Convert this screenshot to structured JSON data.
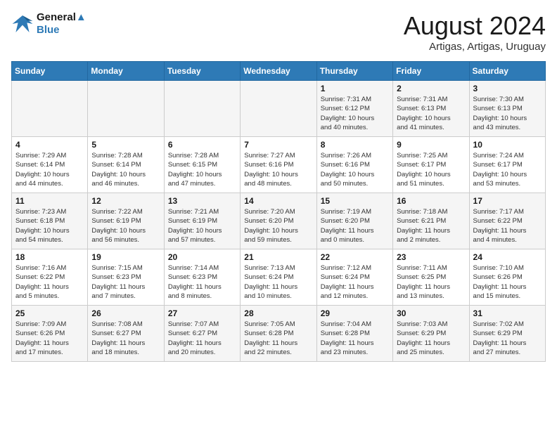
{
  "header": {
    "logo_line1": "General",
    "logo_line2": "Blue",
    "month_title": "August 2024",
    "location": "Artigas, Artigas, Uruguay"
  },
  "weekdays": [
    "Sunday",
    "Monday",
    "Tuesday",
    "Wednesday",
    "Thursday",
    "Friday",
    "Saturday"
  ],
  "weeks": [
    [
      {
        "day": "",
        "info": ""
      },
      {
        "day": "",
        "info": ""
      },
      {
        "day": "",
        "info": ""
      },
      {
        "day": "",
        "info": ""
      },
      {
        "day": "1",
        "info": "Sunrise: 7:31 AM\nSunset: 6:12 PM\nDaylight: 10 hours\nand 40 minutes."
      },
      {
        "day": "2",
        "info": "Sunrise: 7:31 AM\nSunset: 6:13 PM\nDaylight: 10 hours\nand 41 minutes."
      },
      {
        "day": "3",
        "info": "Sunrise: 7:30 AM\nSunset: 6:13 PM\nDaylight: 10 hours\nand 43 minutes."
      }
    ],
    [
      {
        "day": "4",
        "info": "Sunrise: 7:29 AM\nSunset: 6:14 PM\nDaylight: 10 hours\nand 44 minutes."
      },
      {
        "day": "5",
        "info": "Sunrise: 7:28 AM\nSunset: 6:14 PM\nDaylight: 10 hours\nand 46 minutes."
      },
      {
        "day": "6",
        "info": "Sunrise: 7:28 AM\nSunset: 6:15 PM\nDaylight: 10 hours\nand 47 minutes."
      },
      {
        "day": "7",
        "info": "Sunrise: 7:27 AM\nSunset: 6:16 PM\nDaylight: 10 hours\nand 48 minutes."
      },
      {
        "day": "8",
        "info": "Sunrise: 7:26 AM\nSunset: 6:16 PM\nDaylight: 10 hours\nand 50 minutes."
      },
      {
        "day": "9",
        "info": "Sunrise: 7:25 AM\nSunset: 6:17 PM\nDaylight: 10 hours\nand 51 minutes."
      },
      {
        "day": "10",
        "info": "Sunrise: 7:24 AM\nSunset: 6:17 PM\nDaylight: 10 hours\nand 53 minutes."
      }
    ],
    [
      {
        "day": "11",
        "info": "Sunrise: 7:23 AM\nSunset: 6:18 PM\nDaylight: 10 hours\nand 54 minutes."
      },
      {
        "day": "12",
        "info": "Sunrise: 7:22 AM\nSunset: 6:19 PM\nDaylight: 10 hours\nand 56 minutes."
      },
      {
        "day": "13",
        "info": "Sunrise: 7:21 AM\nSunset: 6:19 PM\nDaylight: 10 hours\nand 57 minutes."
      },
      {
        "day": "14",
        "info": "Sunrise: 7:20 AM\nSunset: 6:20 PM\nDaylight: 10 hours\nand 59 minutes."
      },
      {
        "day": "15",
        "info": "Sunrise: 7:19 AM\nSunset: 6:20 PM\nDaylight: 11 hours\nand 0 minutes."
      },
      {
        "day": "16",
        "info": "Sunrise: 7:18 AM\nSunset: 6:21 PM\nDaylight: 11 hours\nand 2 minutes."
      },
      {
        "day": "17",
        "info": "Sunrise: 7:17 AM\nSunset: 6:22 PM\nDaylight: 11 hours\nand 4 minutes."
      }
    ],
    [
      {
        "day": "18",
        "info": "Sunrise: 7:16 AM\nSunset: 6:22 PM\nDaylight: 11 hours\nand 5 minutes."
      },
      {
        "day": "19",
        "info": "Sunrise: 7:15 AM\nSunset: 6:23 PM\nDaylight: 11 hours\nand 7 minutes."
      },
      {
        "day": "20",
        "info": "Sunrise: 7:14 AM\nSunset: 6:23 PM\nDaylight: 11 hours\nand 8 minutes."
      },
      {
        "day": "21",
        "info": "Sunrise: 7:13 AM\nSunset: 6:24 PM\nDaylight: 11 hours\nand 10 minutes."
      },
      {
        "day": "22",
        "info": "Sunrise: 7:12 AM\nSunset: 6:24 PM\nDaylight: 11 hours\nand 12 minutes."
      },
      {
        "day": "23",
        "info": "Sunrise: 7:11 AM\nSunset: 6:25 PM\nDaylight: 11 hours\nand 13 minutes."
      },
      {
        "day": "24",
        "info": "Sunrise: 7:10 AM\nSunset: 6:26 PM\nDaylight: 11 hours\nand 15 minutes."
      }
    ],
    [
      {
        "day": "25",
        "info": "Sunrise: 7:09 AM\nSunset: 6:26 PM\nDaylight: 11 hours\nand 17 minutes."
      },
      {
        "day": "26",
        "info": "Sunrise: 7:08 AM\nSunset: 6:27 PM\nDaylight: 11 hours\nand 18 minutes."
      },
      {
        "day": "27",
        "info": "Sunrise: 7:07 AM\nSunset: 6:27 PM\nDaylight: 11 hours\nand 20 minutes."
      },
      {
        "day": "28",
        "info": "Sunrise: 7:05 AM\nSunset: 6:28 PM\nDaylight: 11 hours\nand 22 minutes."
      },
      {
        "day": "29",
        "info": "Sunrise: 7:04 AM\nSunset: 6:28 PM\nDaylight: 11 hours\nand 23 minutes."
      },
      {
        "day": "30",
        "info": "Sunrise: 7:03 AM\nSunset: 6:29 PM\nDaylight: 11 hours\nand 25 minutes."
      },
      {
        "day": "31",
        "info": "Sunrise: 7:02 AM\nSunset: 6:29 PM\nDaylight: 11 hours\nand 27 minutes."
      }
    ]
  ]
}
